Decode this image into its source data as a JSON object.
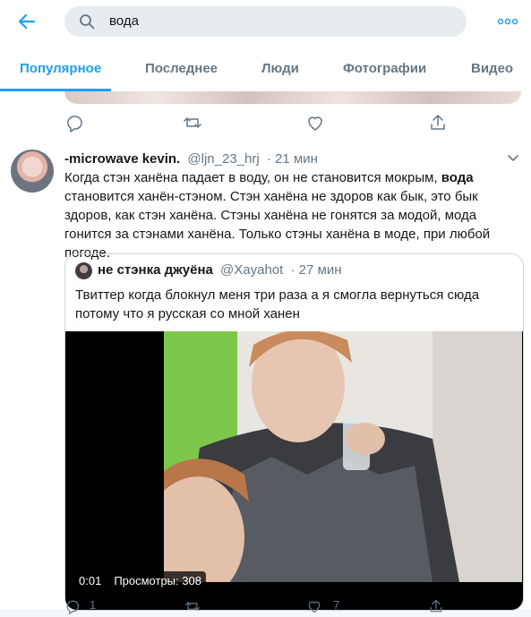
{
  "search": {
    "query": "вода"
  },
  "tabs": [
    {
      "label": "Популярное",
      "active": true
    },
    {
      "label": "Последнее",
      "active": false
    },
    {
      "label": "Люди",
      "active": false
    },
    {
      "label": "Фотографии",
      "active": false
    },
    {
      "label": "Видео",
      "active": false
    }
  ],
  "tweet": {
    "display_name": "-microwave kevin.",
    "handle": "@ljn_23_hrj",
    "time": "· 21 мин",
    "text_before": "Когда стэн ханёна падает в воду, он не становится мокрым, ",
    "text_bold": "вода",
    "text_after": " становится ханён-стэном. Стэн ханёна не здоров как бык, это бык здоров, как стэн ханёна. Стэны ханёна не гонятся за модой, мода гонится за стэнами ханёна. Только стэны ханёна в моде, при любой погоде."
  },
  "quote": {
    "display_name": "не стэнка джуёна",
    "handle": "@Xayahot",
    "time": "· 27 мин",
    "text": "Твиттер когда блокнул меня три раза а я смогла вернуться сюда потому что я русская со мной ханен",
    "video_duration": "0:01",
    "video_views": "Просмотры: 308"
  },
  "actions": {
    "reply_count": "1",
    "like_count": "7"
  },
  "colors": {
    "accent": "#1da1f2",
    "secondary_text": "#657786",
    "border": "#e6ecf0"
  },
  "icons": [
    "back-arrow-icon",
    "search-icon",
    "more-icon",
    "reply-icon",
    "retweet-icon",
    "like-icon",
    "share-icon",
    "caret-down-icon"
  ]
}
